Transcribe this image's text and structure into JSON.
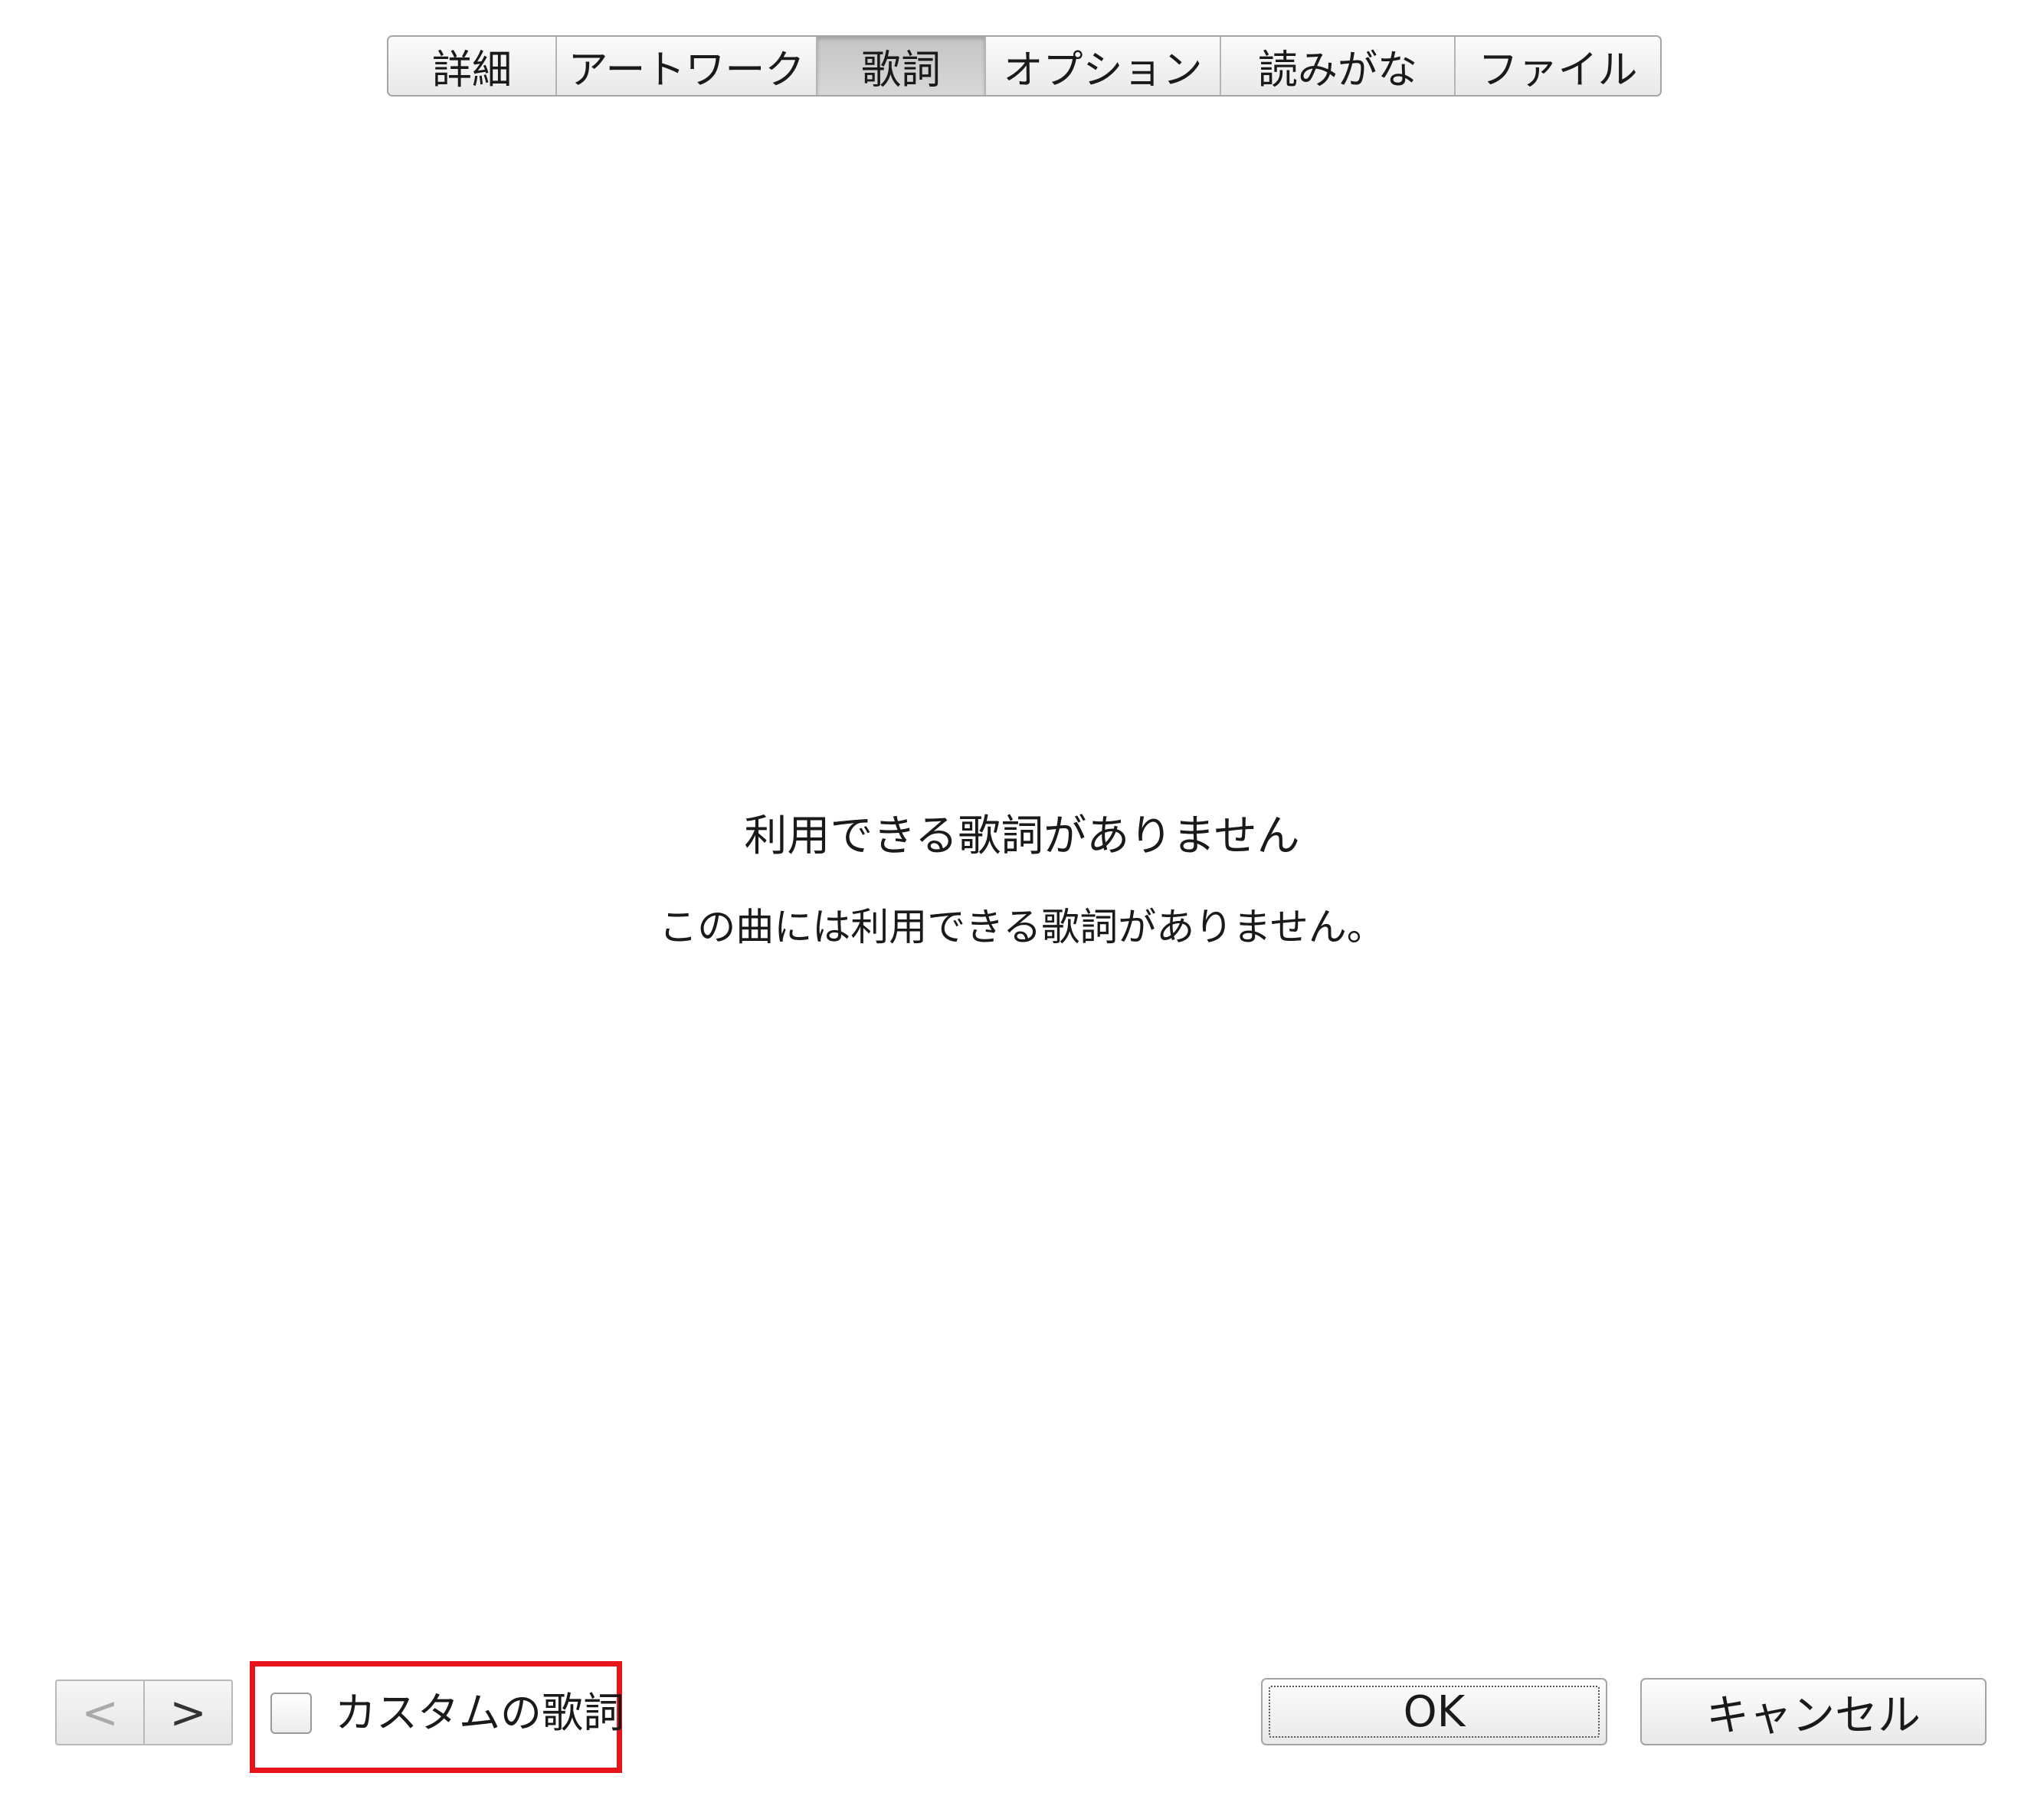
{
  "tabs": [
    {
      "label": "詳細",
      "selected": false
    },
    {
      "label": "アートワーク",
      "selected": false
    },
    {
      "label": "歌詞",
      "selected": true
    },
    {
      "label": "オプション",
      "selected": false
    },
    {
      "label": "読みがな",
      "selected": false
    },
    {
      "label": "ファイル",
      "selected": false
    }
  ],
  "message": {
    "title": "利用できる歌詞がありません",
    "body": "この曲には利用できる歌詞がありません。"
  },
  "footer": {
    "prev_icon": "chevron-left-icon",
    "next_icon": "chevron-right-icon",
    "prev_glyph": "<",
    "next_glyph": ">",
    "custom_lyrics_label": "カスタムの歌詞",
    "custom_lyrics_checked": false,
    "ok_label": "OK",
    "cancel_label": "キャンセル"
  },
  "colors": {
    "highlight": "#e8141b",
    "selected_tab": "#c9c9c9"
  }
}
